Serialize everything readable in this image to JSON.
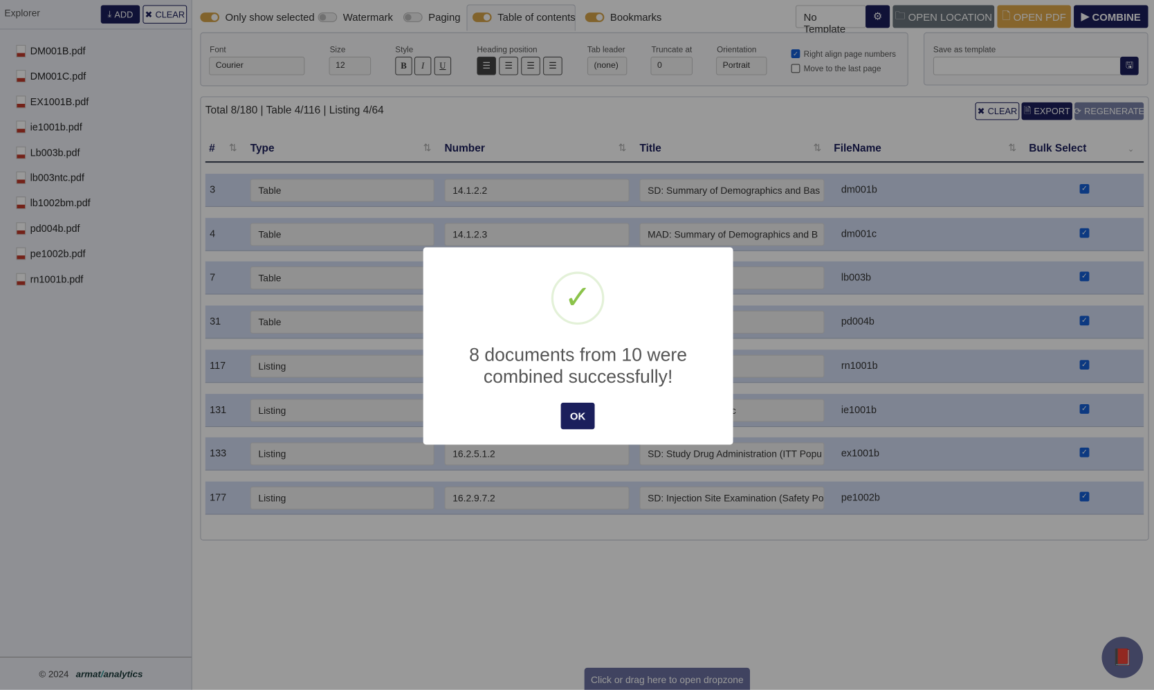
{
  "sidebar": {
    "title": "Explorer",
    "add_label": "ADD",
    "clear_label": "CLEAR",
    "files": [
      "DM001B.pdf",
      "DM001C.pdf",
      "EX1001B.pdf",
      "ie1001b.pdf",
      "Lb003b.pdf",
      "lb003ntc.pdf",
      "lb1002bm.pdf",
      "pd004b.pdf",
      "pe1002b.pdf",
      "rn1001b.pdf"
    ],
    "footer_copyright": "© 2024",
    "logo_text": "armat analytics"
  },
  "toolbar": {
    "toggles": [
      {
        "label": "Only show selected",
        "on": true
      },
      {
        "label": "Watermark",
        "on": false
      },
      {
        "label": "Paging",
        "on": false
      },
      {
        "label": "Table of contents",
        "on": true
      },
      {
        "label": "Bookmarks",
        "on": true
      }
    ],
    "template_select": "No Template",
    "open_location": "OPEN LOCATION",
    "open_pdf": "OPEN PDF",
    "combine": "COMBINE"
  },
  "settings": {
    "font_label": "Font",
    "font_value": "Courier",
    "size_label": "Size",
    "size_value": "12",
    "style_label": "Style",
    "bold": "B",
    "italic": "I",
    "underline": "U",
    "heading_label": "Heading position",
    "tab_leader_label": "Tab leader",
    "tab_leader_value": "(none)",
    "truncate_label": "Truncate at",
    "truncate_value": "0",
    "orientation_label": "Orientation",
    "orientation_value": "Portrait",
    "right_align_label": "Right align page numbers",
    "right_align_checked": true,
    "move_last_label": "Move to the last page",
    "move_last_checked": false,
    "save_template_label": "Save as template",
    "save_template_value": ""
  },
  "table": {
    "summary": "Total 8/180 | Table 4/116 | Listing 4/64",
    "clear": "CLEAR",
    "export": "EXPORT",
    "regenerate": "REGENERATE",
    "headers": [
      "#",
      "Type",
      "Number",
      "Title",
      "FileName",
      "Bulk Select"
    ],
    "rows": [
      {
        "num": "3",
        "type": "Table",
        "number": "14.1.2.2",
        "title": "SD: Summary of Demographics and Bas",
        "file": "dm001b",
        "checked": true
      },
      {
        "num": "4",
        "type": "Table",
        "number": "14.1.2.3",
        "title": "MAD: Summary of Demographics and B",
        "file": "dm001c",
        "checked": true
      },
      {
        "num": "7",
        "type": "Table",
        "number": "",
        "title": "nge in Serum log1(",
        "file": "lb003b",
        "checked": true
      },
      {
        "num": "31",
        "type": "Table",
        "number": "",
        "title": "ticipants with Detec",
        "file": "pd004b",
        "checked": true
      },
      {
        "num": "117",
        "type": "Listing",
        "number": "",
        "title": "ions and Randomiz",
        "file": "rn1001b",
        "checked": true
      },
      {
        "num": "131",
        "type": "Listing",
        "number": "",
        "title": "a (Enrolled Populatic",
        "file": "ie1001b",
        "checked": true
      },
      {
        "num": "133",
        "type": "Listing",
        "number": "16.2.5.1.2",
        "title": "SD: Study Drug Administration (ITT Popu",
        "file": "ex1001b",
        "checked": true
      },
      {
        "num": "177",
        "type": "Listing",
        "number": "16.2.9.7.2",
        "title": "SD: Injection Site Examination (Safety Po",
        "file": "pe1002b",
        "checked": true
      }
    ]
  },
  "dropzone": "Click or drag here to open dropzone",
  "modal": {
    "line1": "8 documents from 10 were",
    "line2": "combined successfully!",
    "ok": "OK"
  },
  "colors": {
    "navy": "#1b1f5c",
    "gold": "#d8a54a",
    "success": "#8bc34a"
  }
}
